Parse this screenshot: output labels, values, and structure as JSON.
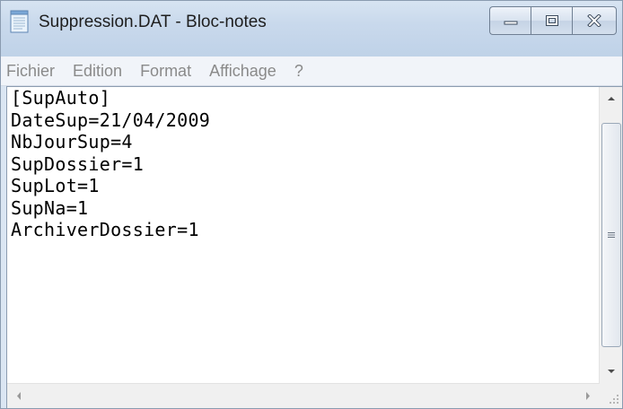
{
  "window": {
    "title": "Suppression.DAT - Bloc-notes",
    "app_icon": "notepad-icon"
  },
  "caption_buttons": {
    "minimize_icon": "minimize-icon",
    "maximize_icon": "maximize-icon",
    "close_icon": "close-icon"
  },
  "menu": {
    "items": [
      {
        "label": "Fichier"
      },
      {
        "label": "Edition"
      },
      {
        "label": "Format"
      },
      {
        "label": "Affichage"
      },
      {
        "label": "?"
      }
    ]
  },
  "editor": {
    "lines": [
      "[SupAuto]",
      "DateSup=21/04/2009",
      "NbJourSup=4",
      "SupDossier=1",
      "SupLot=1",
      "SupNa=1",
      "ArchiverDossier=1"
    ]
  },
  "scrollbars": {
    "up_icon": "scroll-up-arrow-icon",
    "down_icon": "scroll-down-arrow-icon",
    "left_icon": "scroll-left-arrow-icon",
    "right_icon": "scroll-right-arrow-icon",
    "grip_icon": "size-grip-icon"
  }
}
